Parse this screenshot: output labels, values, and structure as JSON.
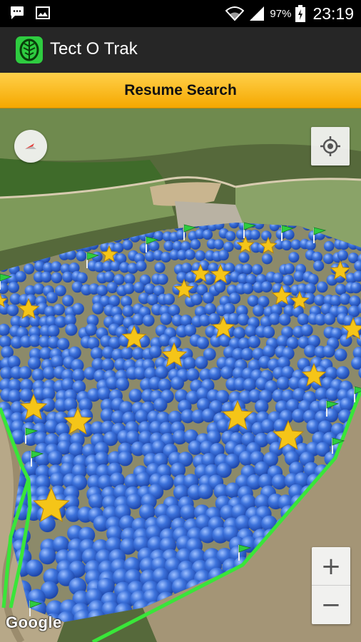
{
  "status_bar": {
    "battery_percent": "97%",
    "time": "23:19",
    "icons": [
      "chat-bubble-icon",
      "image-icon",
      "wifi-icon",
      "signal-icon",
      "battery-icon"
    ]
  },
  "app": {
    "title": "Tect O Trak",
    "logo_icon": "tree-icon"
  },
  "resume_button": {
    "label": "Resume Search"
  },
  "map": {
    "attribution": "Google",
    "zoom_in_label": "+",
    "zoom_out_label": "−",
    "compass_icon": "compass-icon",
    "locate_icon": "my-location-icon",
    "colors": {
      "accent": "#f7b51c",
      "marker_blue": "#3a6fd8",
      "star_gold": "#f5c518",
      "boundary_green": "#39e639"
    }
  }
}
